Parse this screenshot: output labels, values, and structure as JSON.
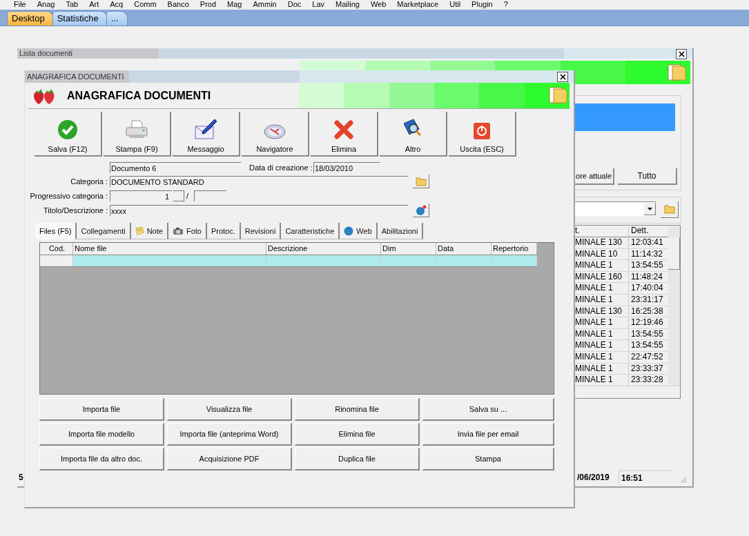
{
  "menu_bar": [
    "File",
    "Anag",
    "Tab",
    "Art",
    "Acq",
    "Comm",
    "Banco",
    "Prod",
    "Mag",
    "Ammin",
    "Doc",
    "Lav",
    "Mailing",
    "Web",
    "Marketplace",
    "Util",
    "Plugin",
    "?"
  ],
  "desktop_tabs": [
    {
      "label": "Desktop",
      "selected": true
    },
    {
      "label": "Statistiche",
      "selected": false
    },
    {
      "label": "...",
      "selected": false
    }
  ],
  "background_window": {
    "title": "Lista documenti",
    "buttons": [
      "ore attuale",
      "Tutto"
    ],
    "table": {
      "columns": [
        "t.",
        "Dett."
      ],
      "rows": [
        [
          "MINALE 130",
          "12:03:41"
        ],
        [
          "MINALE 10",
          "11:14:32"
        ],
        [
          "MINALE 1",
          "13:54:55"
        ],
        [
          "MINALE 160",
          "11:48:24"
        ],
        [
          "MINALE 1",
          "17:40:04"
        ],
        [
          "MINALE 1",
          "23:31:17"
        ],
        [
          "MINALE 130",
          "16:25:38"
        ],
        [
          "MINALE 1",
          "12:19:46"
        ],
        [
          "MINALE 1",
          "13:54:55"
        ],
        [
          "MINALE 1",
          "13:54:55"
        ],
        [
          "MINALE 1",
          "22:47:52"
        ],
        [
          "MINALE 1",
          "23:33:37"
        ],
        [
          "MINALE 1",
          "23:33:28"
        ]
      ]
    },
    "status_bar": [
      "5",
      "/06/2019",
      "16:51"
    ]
  },
  "dialog": {
    "title": "ANAGRAFICA DOCUMENTI",
    "heading": "ANAGRAFICA DOCUMENTI",
    "toolbar": [
      {
        "label": "Salva (F12)",
        "kind": "check"
      },
      {
        "label": "Stampa (F9)",
        "kind": "printer"
      },
      {
        "label": "Messaggio",
        "kind": "envelope"
      },
      {
        "label": "Navigatore",
        "kind": "compass"
      },
      {
        "label": "Elimina",
        "kind": "cross"
      },
      {
        "label": "Altro",
        "kind": "book"
      },
      {
        "label": "Uscita (ESC)",
        "kind": "power"
      }
    ],
    "form": {
      "name": "Documento 6",
      "creation_date_label": "Data di creazione :",
      "creation_date": "18/03/2010",
      "category_label": "Categoria :",
      "category": "DOCUMENTO STANDARD",
      "progressive_label": "Progressivo categoria :",
      "progressive": "1",
      "progressive_separator": "/",
      "title_label": "Titolo/Descrizione :",
      "title": "xxxx"
    },
    "tabs": [
      {
        "label": "Files (F5)",
        "selected": true
      },
      {
        "label": "Collegamenti",
        "selected": false
      },
      {
        "label": "Note",
        "selected": false,
        "kind": "note"
      },
      {
        "label": "Foto",
        "selected": false,
        "kind": "camera"
      },
      {
        "label": "Protoc.",
        "selected": false
      },
      {
        "label": "Revisioni",
        "selected": false
      },
      {
        "label": "Caratteristiche",
        "selected": false
      },
      {
        "label": "Web",
        "selected": false,
        "kind": "globe"
      },
      {
        "label": "Abilitazioni",
        "selected": false
      }
    ],
    "files_table": {
      "columns": [
        "Cod.",
        "Nome file",
        "Descrizione",
        "Dim",
        "Data",
        "Repertorio"
      ],
      "rows": [
        {
          "selected": true
        }
      ]
    },
    "actions": [
      "Importa file",
      "Visualizza file",
      "Rinomina file",
      "Salva su ...",
      "Importa file modello",
      "Importa file (anteprima Word)",
      "Elimina file",
      "Invia file per email",
      "Importa file da altro doc.",
      "Acquisizione PDF",
      "Duplica file",
      "Stampa"
    ]
  }
}
